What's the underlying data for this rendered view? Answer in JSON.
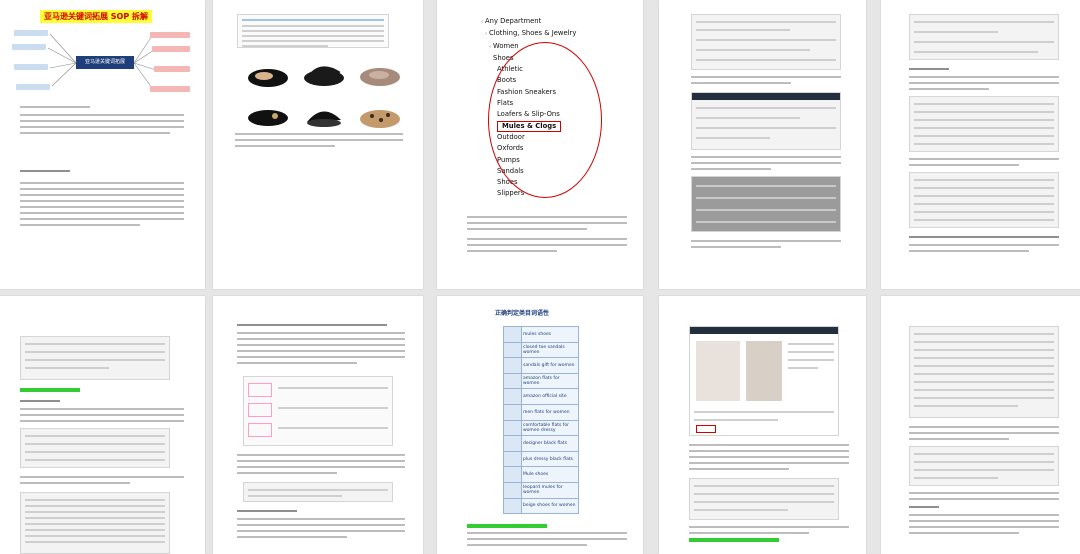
{
  "document": {
    "title": "亚马逊关键词拓展 SOP 拆解",
    "mindmap_center": "亚马逊关键词拓展"
  },
  "department_nav": {
    "items": [
      {
        "label": "Any Department",
        "level": 0,
        "chevron": "‹"
      },
      {
        "label": "Clothing, Shoes & Jewelry",
        "level": 1,
        "chevron": "‹"
      },
      {
        "label": "Women",
        "level": 2,
        "chevron": "‹"
      },
      {
        "label": "Shoes",
        "level": 3,
        "chevron": ""
      },
      {
        "label": "Athletic",
        "level": 4,
        "chevron": ""
      },
      {
        "label": "Boots",
        "level": 4,
        "chevron": ""
      },
      {
        "label": "Fashion Sneakers",
        "level": 4,
        "chevron": ""
      },
      {
        "label": "Flats",
        "level": 4,
        "chevron": ""
      },
      {
        "label": "Loafers & Slip-Ons",
        "level": 4,
        "chevron": ""
      },
      {
        "label": "Mules & Clogs",
        "level": 4,
        "chevron": "",
        "selected": true
      },
      {
        "label": "Outdoor",
        "level": 4,
        "chevron": ""
      },
      {
        "label": "Oxfords",
        "level": 4,
        "chevron": ""
      },
      {
        "label": "Pumps",
        "level": 4,
        "chevron": ""
      },
      {
        "label": "Sandals",
        "level": 4,
        "chevron": ""
      },
      {
        "label": "Shoes",
        "level": 4,
        "chevron": ""
      },
      {
        "label": "Slippers",
        "level": 4,
        "chevron": ""
      }
    ]
  },
  "keyword_table": {
    "title": "正确判定类目词语性",
    "rows": [
      {
        "text": "mules shoes"
      },
      {
        "text": "closed toe sandals women"
      },
      {
        "text": "sandals gift for women"
      },
      {
        "text": "amazon flats for women"
      },
      {
        "text": "amazon official site"
      },
      {
        "text": "men flats for women"
      },
      {
        "text": "comfortable flats for women dressy"
      },
      {
        "text": "designer black flats"
      },
      {
        "text": "plus dressy black flats"
      },
      {
        "text": "Mule shoes"
      },
      {
        "text": "leopard mules for women"
      },
      {
        "text": "beige shoes for women"
      }
    ]
  },
  "colors": {
    "accent_red": "#d40000",
    "highlight_yellow": "#ffff33",
    "highlight_green": "#33cc33",
    "nav_blue": "#1f3f7a",
    "amazon_header": "#232f3e"
  }
}
